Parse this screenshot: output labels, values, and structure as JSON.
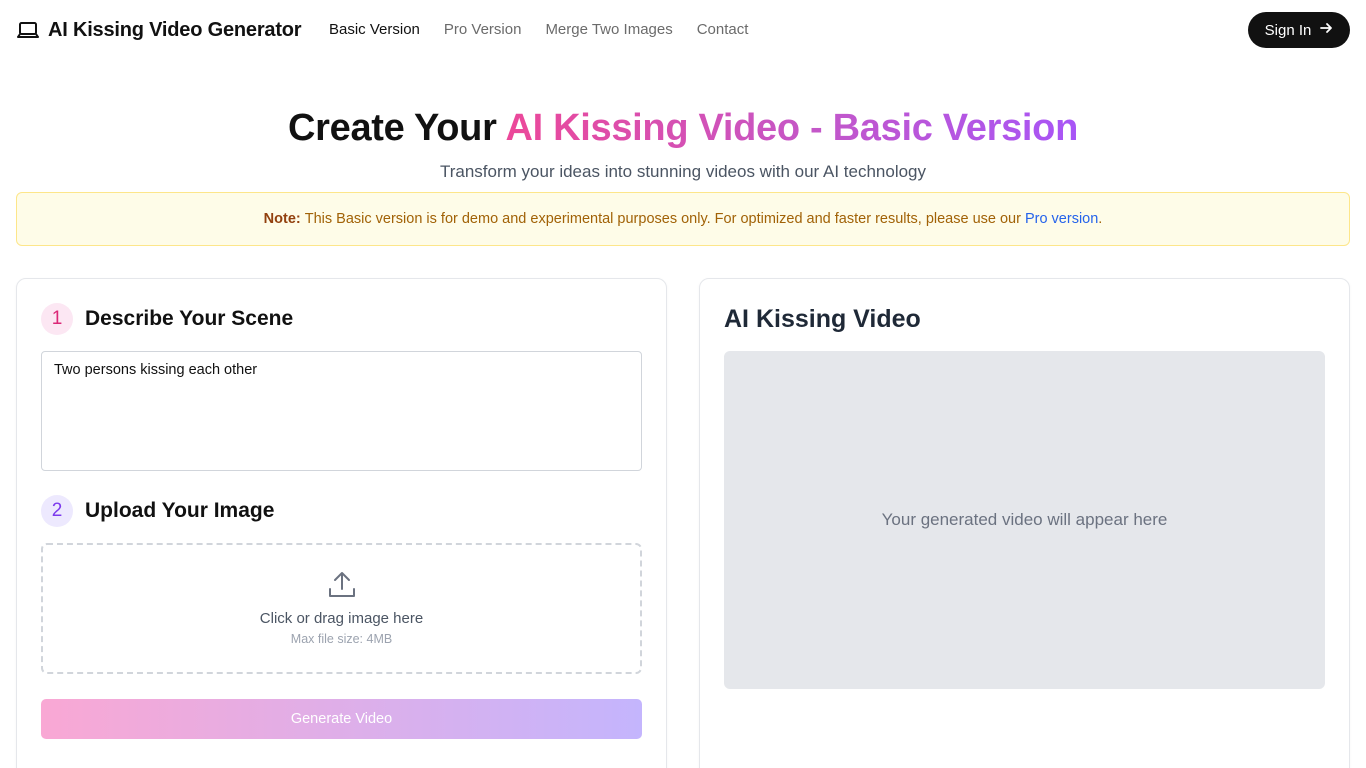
{
  "header": {
    "brand": "AI Kissing Video Generator",
    "brand_icon": "laptop-icon",
    "nav": [
      "Basic Version",
      "Pro Version",
      "Merge Two Images",
      "Contact"
    ],
    "active_nav": "Basic Version",
    "signin_label": "Sign In",
    "signin_icon": "arrow-right-icon"
  },
  "hero": {
    "title_prefix": "Create Your ",
    "title_highlight": "AI Kissing Video - Basic Version",
    "subtitle": "Transform your ideas into stunning videos with our AI technology"
  },
  "note": {
    "label": "Note:",
    "text": "This Basic version is for demo and experimental purposes only. For optimized and faster results, please use our",
    "link": "Pro version",
    "suffix": "."
  },
  "form": {
    "step1": {
      "number": "1",
      "title": "Describe Your Scene",
      "value": "Two persons kissing each other"
    },
    "step2": {
      "number": "2",
      "title": "Upload Your Image",
      "drop_text": "Click or drag image here",
      "drop_sub": "Max file size: 4MB",
      "icon": "upload-icon"
    },
    "generate_label": "Generate Video"
  },
  "output": {
    "title": "AI Kissing Video",
    "placeholder": "Your generated video will appear here"
  },
  "colors": {
    "accent_pink": "#ec4899",
    "accent_purple": "#a855f7",
    "note_bg": "#fefce8",
    "link_blue": "#2563eb"
  }
}
